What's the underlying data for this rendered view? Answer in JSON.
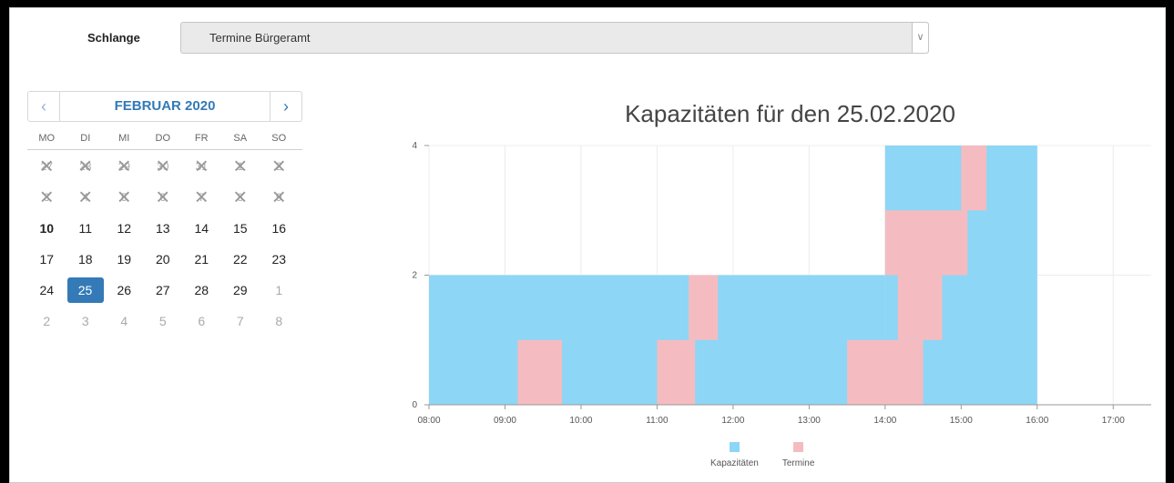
{
  "queue": {
    "label": "Schlange",
    "value": "Termine Bürgeramt"
  },
  "calendar": {
    "month": "FEBRUAR 2020",
    "weekdays": [
      "MO",
      "DI",
      "MI",
      "DO",
      "FR",
      "SA",
      "SO"
    ],
    "weeks": [
      [
        "27",
        "28",
        "29",
        "30",
        "31",
        "1",
        "2"
      ],
      [
        "3",
        "4",
        "5",
        "6",
        "7",
        "8",
        "9"
      ],
      [
        "10",
        "11",
        "12",
        "13",
        "14",
        "15",
        "16"
      ],
      [
        "17",
        "18",
        "19",
        "20",
        "21",
        "22",
        "23"
      ],
      [
        "24",
        "25",
        "26",
        "27",
        "28",
        "29",
        "1"
      ],
      [
        "2",
        "3",
        "4",
        "5",
        "6",
        "7",
        "8"
      ]
    ],
    "past_cells": 14,
    "today": "10",
    "selected": "25",
    "colors": {
      "accent": "#337ab7"
    }
  },
  "chart_data": {
    "type": "area",
    "title": "Kapazitäten für den 25.02.2020",
    "xlabel": "",
    "ylabel": "",
    "xlim": [
      "08:00",
      "17:30"
    ],
    "ylim": [
      0,
      4
    ],
    "x_ticks": [
      "08:00",
      "09:00",
      "10:00",
      "11:00",
      "12:00",
      "13:00",
      "14:00",
      "15:00",
      "16:00",
      "17:00"
    ],
    "y_ticks": [
      "0",
      "2",
      "4"
    ],
    "grid": true,
    "legend_position": "bottom",
    "series": [
      {
        "name": "Kapazitäten",
        "color": "#8dd6f5",
        "steps": [
          {
            "from": "08:00",
            "to": "14:00",
            "value": 2
          },
          {
            "from": "14:00",
            "to": "16:00",
            "value": 4
          }
        ]
      },
      {
        "name": "Termine",
        "color": "#f4bcc1",
        "blocks": [
          {
            "from": "09:10",
            "to": "09:45",
            "y0": 0,
            "y1": 1
          },
          {
            "from": "11:00",
            "to": "11:30",
            "y0": 0,
            "y1": 1
          },
          {
            "from": "11:25",
            "to": "11:48",
            "y0": 1,
            "y1": 2
          },
          {
            "from": "13:30",
            "to": "14:30",
            "y0": 0,
            "y1": 1
          },
          {
            "from": "14:10",
            "to": "14:45",
            "y0": 1,
            "y1": 2
          },
          {
            "from": "14:00",
            "to": "15:05",
            "y0": 2,
            "y1": 3
          },
          {
            "from": "15:00",
            "to": "15:20",
            "y0": 3,
            "y1": 4
          }
        ]
      }
    ]
  }
}
